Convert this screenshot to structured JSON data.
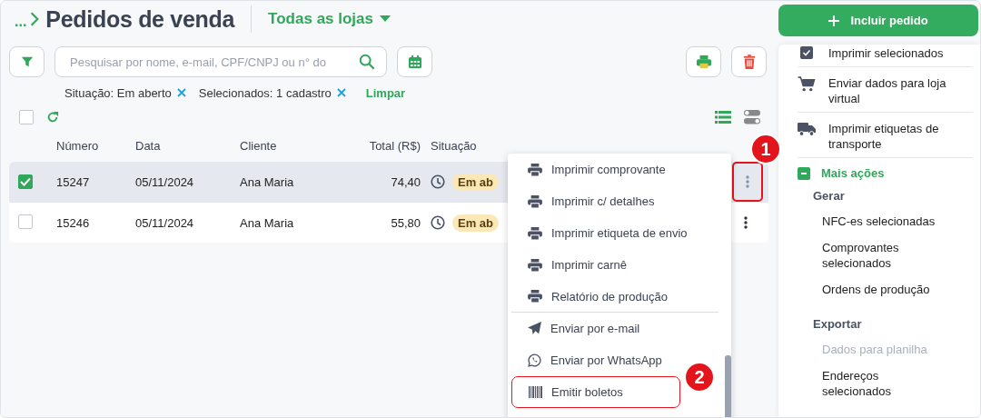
{
  "breadcrumb": "...",
  "title": "Pedidos de venda",
  "store_selector": "Todas as lojas",
  "search": {
    "placeholder": "Pesquisar por nome, e-mail, CPF/CNPJ ou n° do"
  },
  "filters": [
    {
      "label": "Situação: Em aberto"
    },
    {
      "label": "Selecionados: 1 cadastro"
    }
  ],
  "clear_filters": "Limpar",
  "select_all": {
    "checked": false
  },
  "table": {
    "columns": [
      "Número",
      "Data",
      "Cliente",
      "Total (R$)",
      "Situação"
    ],
    "rows": [
      {
        "selected": true,
        "number": "15247",
        "date": "05/11/2024",
        "customer": "Ana Maria",
        "total": "74,40",
        "status": "Em ab",
        "highlighted": true,
        "callout": "1"
      },
      {
        "selected": false,
        "number": "15246",
        "date": "05/11/2024",
        "customer": "Ana Maria",
        "total": "55,80",
        "status": "Em ab",
        "highlighted": false
      }
    ]
  },
  "row_menu": {
    "items": [
      {
        "kind": "print",
        "label": "Imprimir comprovante",
        "divider": false,
        "highlighted": false
      },
      {
        "kind": "print",
        "label": "Imprimir c/ detalhes",
        "divider": false,
        "highlighted": false
      },
      {
        "kind": "print",
        "label": "Imprimir etiqueta de envio",
        "divider": false,
        "highlighted": false
      },
      {
        "kind": "print",
        "label": "Imprimir carnê",
        "divider": false,
        "highlighted": false
      },
      {
        "kind": "print",
        "label": "Relatório de produção",
        "divider": true,
        "highlighted": false
      },
      {
        "kind": "send",
        "label": "Enviar por e-mail",
        "divider": false,
        "highlighted": false
      },
      {
        "kind": "whatsapp",
        "label": "Enviar por WhatsApp",
        "divider": false,
        "highlighted": false
      },
      {
        "kind": "barcode",
        "label": "Emitir boletos",
        "divider": false,
        "highlighted": true,
        "callout": "2"
      }
    ]
  },
  "add_button": "Incluir pedido",
  "actions_panel": {
    "items": [
      {
        "kind": "checkbox",
        "label": "Imprimir selecionados"
      },
      {
        "kind": "cart",
        "label": "Enviar dados para loja virtual"
      },
      {
        "kind": "truck",
        "label": "Imprimir etiquetas de transporte"
      }
    ],
    "more": {
      "label": "Mais ações",
      "expanded": true,
      "groups": [
        {
          "title": "Gerar",
          "items": [
            {
              "label": "NFC-es selecionadas",
              "disabled": false
            },
            {
              "label": "Comprovantes selecionados",
              "disabled": false
            },
            {
              "label": "Ordens de produção",
              "disabled": false
            }
          ]
        },
        {
          "title": "Exportar",
          "items": [
            {
              "label": "Dados para planilha",
              "disabled": true
            },
            {
              "label": "Endereços selecionados",
              "disabled": false
            }
          ]
        }
      ]
    }
  }
}
